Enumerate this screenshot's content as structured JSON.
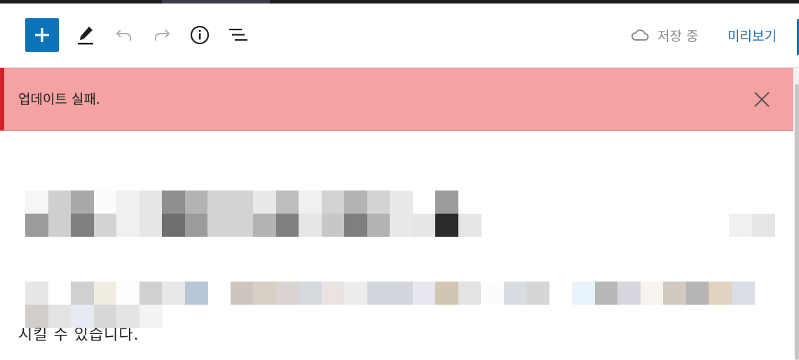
{
  "toolbar": {
    "saving_label": "저장 중",
    "preview_label": "미리보기"
  },
  "notice": {
    "message": "업데이트 실패."
  },
  "content": {
    "paragraph_tail": "시킬 수 있습니다."
  },
  "colors": {
    "accent": "#0a73ba",
    "notice_bg": "#f4a2a2",
    "notice_bar": "#d12229",
    "link": "#1d6fb3"
  },
  "icons": [
    "plus-icon",
    "pencil-icon",
    "undo-icon",
    "redo-icon",
    "info-icon",
    "list-view-icon",
    "cloud-icon",
    "close-icon"
  ]
}
